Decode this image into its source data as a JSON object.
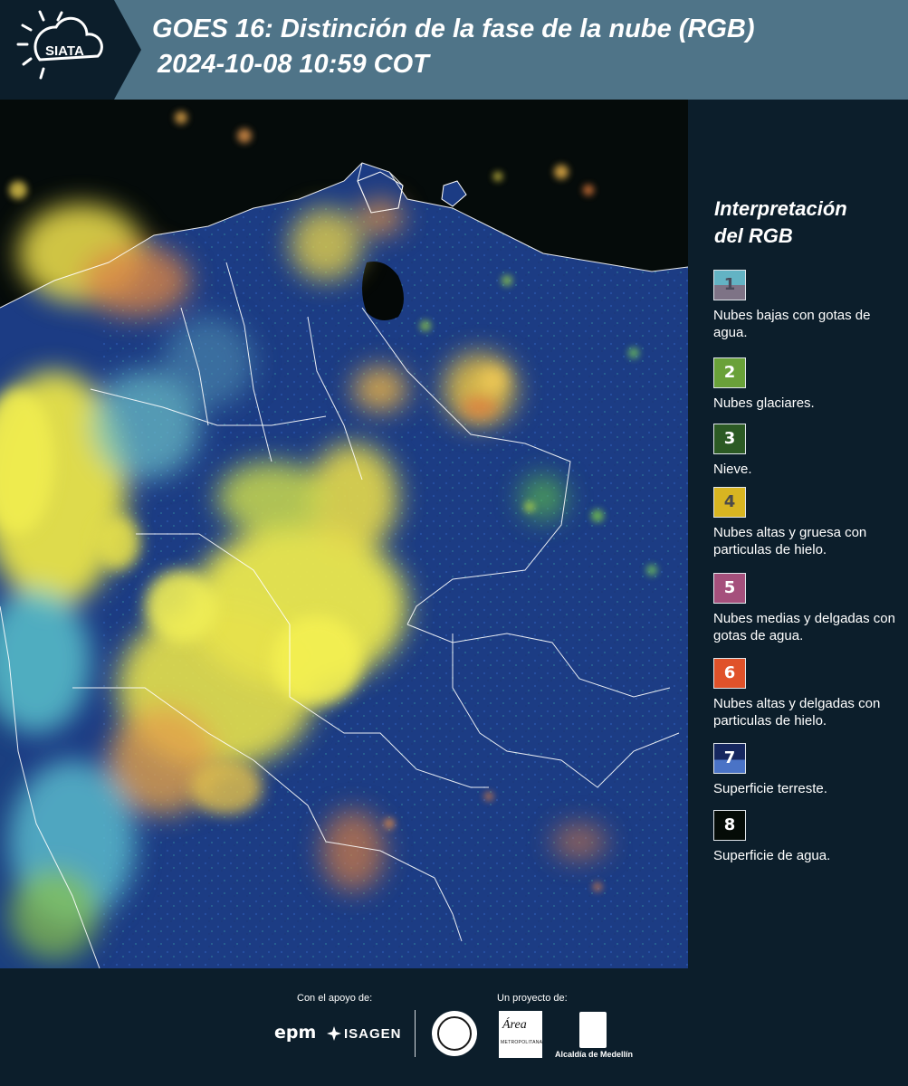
{
  "header": {
    "logo_text": "SIATA",
    "title_line1": "GOES 16: Distinción de la fase de la nube (RGB)",
    "title_line2": "2024-10-08 10:59 COT"
  },
  "legend": {
    "title_line1": "Interpretación",
    "title_line2": "del RGB",
    "items": [
      {
        "num": "1",
        "text": "Nubes bajas con gotas de agua.",
        "color_top": "#63b3c4",
        "color_bottom": "#7e7386",
        "num_color": "#4a4a5a"
      },
      {
        "num": "2",
        "text": "Nubes glaciares.",
        "color_top": "#6aa139",
        "color_bottom": "#6aa139",
        "num_color": "#ffffff"
      },
      {
        "num": "3",
        "text": "Nieve.",
        "color_top": "#2c5a24",
        "color_bottom": "#2c5a24",
        "num_color": "#ffffff"
      },
      {
        "num": "4",
        "text": "Nubes altas y gruesa con particulas de hielo.",
        "color_top": "#d8b521",
        "color_bottom": "#d8b521",
        "num_color": "#4a4a4a"
      },
      {
        "num": "5",
        "text": "Nubes medias y delgadas con gotas de agua.",
        "color_top": "#a5507c",
        "color_bottom": "#a5507c",
        "num_color": "#ffffff"
      },
      {
        "num": "6",
        "text": "Nubes altas y delgadas con particulas de hielo.",
        "color_top": "#e0522a",
        "color_bottom": "#e0522a",
        "num_color": "#ffffff"
      },
      {
        "num": "7",
        "text": "Superficie terreste.",
        "color_top": "#16275f",
        "color_bottom": "#4a73c6",
        "num_color": "#ffffff"
      },
      {
        "num": "8",
        "text": "Superficie de agua.",
        "color_top": "#050c07",
        "color_bottom": "#050c07",
        "num_color": "#ffffff"
      }
    ]
  },
  "footer": {
    "support_label": "Con el apoyo de:",
    "project_label": "Un proyecto de:",
    "sponsor_epm": "epm",
    "sponsor_isagen": "ISAGEN",
    "amva_name": "Área",
    "amva_sub": "METROPOLITANA",
    "alcaldia": "Alcaldía de Medellín"
  },
  "colors": {
    "header_bg": "#4f7488",
    "page_bg": "#0c1e2b",
    "land": "#1d3f86",
    "water": "#0a1410",
    "cloud_yellow": "#e8e244",
    "cloud_cyan": "#5fd0d8",
    "cloud_orange": "#e07a3a"
  }
}
